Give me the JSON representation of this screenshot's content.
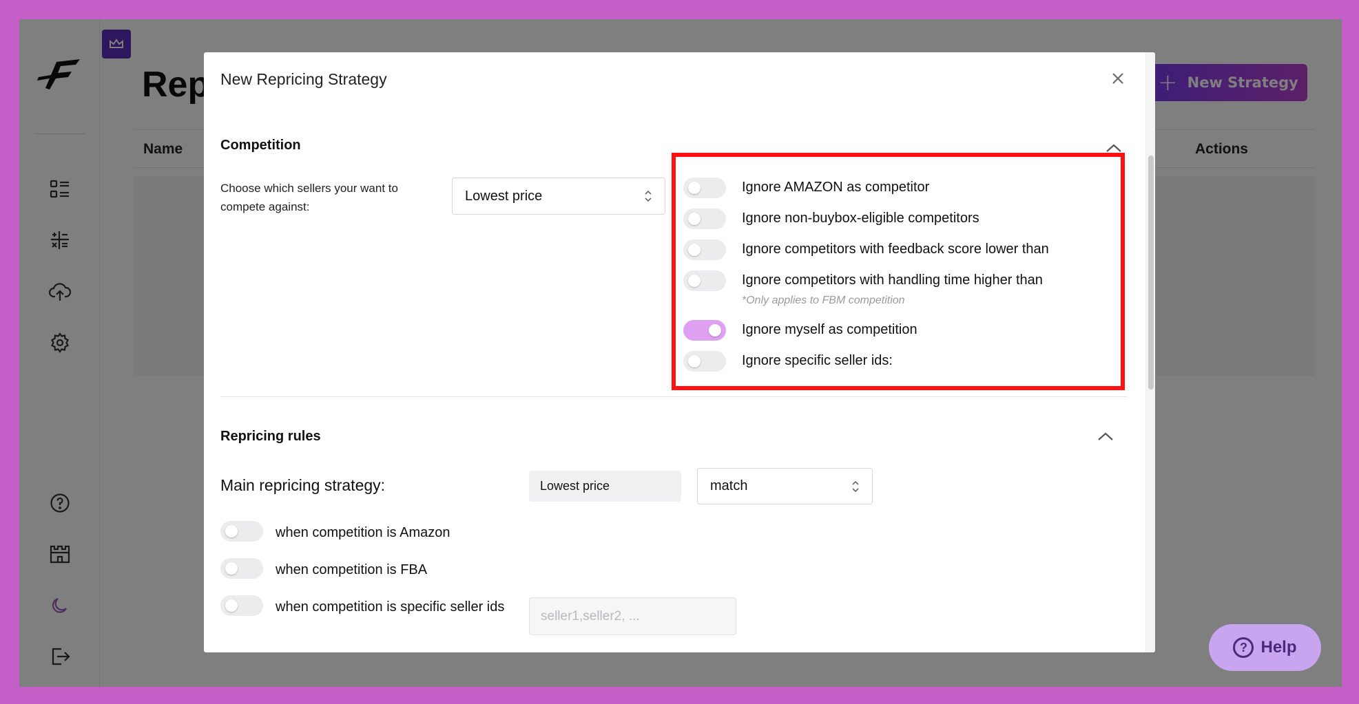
{
  "background_page": {
    "title": "Rep",
    "new_strategy_label": "New Strategy",
    "table_headers": {
      "name": "Name",
      "actions": "Actions"
    }
  },
  "sidebar": {
    "icons": [
      "dashboard-list-icon",
      "calculator-icon",
      "cloud-upload-icon",
      "settings-gear-icon",
      "help-circle-icon",
      "castle-icon",
      "moon-icon",
      "logout-icon"
    ]
  },
  "help_fab": {
    "label": "Help"
  },
  "modal": {
    "title": "New Repricing Strategy",
    "competition": {
      "title": "Competition",
      "sellers_label": "Choose which sellers your want to compete against:",
      "sellers_value": "Lowest price",
      "options": [
        {
          "label": "Ignore AMAZON as competitor",
          "on": false
        },
        {
          "label": "Ignore non-buybox-eligible competitors",
          "on": false
        },
        {
          "label": "Ignore competitors with feedback score lower than",
          "on": false
        },
        {
          "label": "Ignore competitors with handling time higher than",
          "on": false,
          "note": "*Only applies to FBM competition"
        },
        {
          "label": "Ignore myself as competition",
          "on": true
        },
        {
          "label": "Ignore specific seller ids:",
          "on": false
        }
      ]
    },
    "repricing_rules": {
      "title": "Repricing rules",
      "main_label": "Main repricing strategy:",
      "main_strategy_value": "Lowest price",
      "match_value": "match",
      "rules": [
        {
          "label": "when competition is Amazon",
          "on": false
        },
        {
          "label": "when competition is FBA",
          "on": false
        },
        {
          "label": "when competition is specific seller ids",
          "on": false
        }
      ],
      "seller_ids_placeholder": "seller1,seller2, ..."
    }
  },
  "colors": {
    "accent": "#7a3df0",
    "toggle_on": "#e0a0f2",
    "highlight": "#ff1111"
  }
}
